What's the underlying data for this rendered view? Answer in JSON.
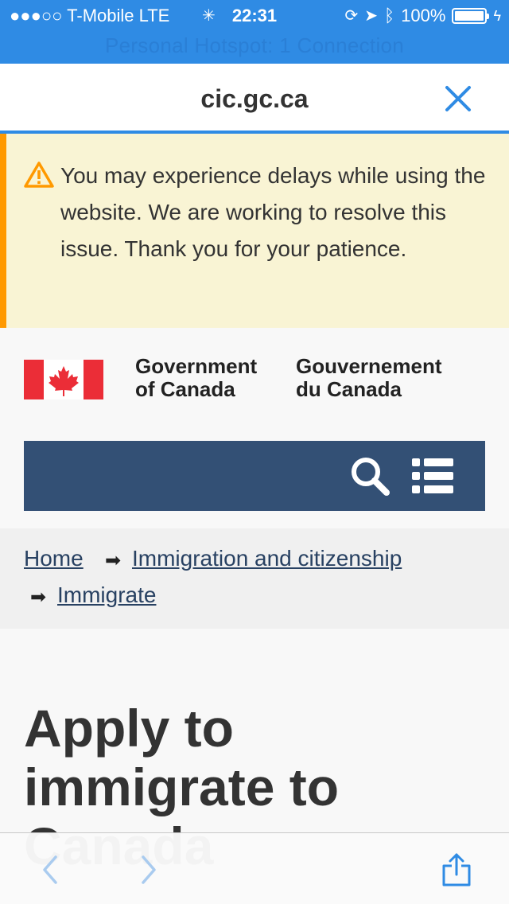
{
  "status_bar": {
    "carrier": "●●●○○ T-Mobile  LTE",
    "time": "22:31",
    "battery": "100%",
    "battery_level": 1.0,
    "hotspot_banner": "Personal Hotspot: 1 Connection"
  },
  "browser": {
    "url": "cic.gc.ca",
    "accent": "#2f8be4"
  },
  "alert": {
    "text": "You may experience delays while using the website. We are working to resolve this issue. Thank you for your patience."
  },
  "header": {
    "gov_en": "Government of Canada",
    "gov_fr": "Gouvernement du Canada",
    "nav_color": "#335075"
  },
  "breadcrumb": {
    "items": [
      "Home",
      "Immigration and citizenship",
      "Immigrate"
    ]
  },
  "main": {
    "title": "Apply to immigrate to Canada"
  }
}
